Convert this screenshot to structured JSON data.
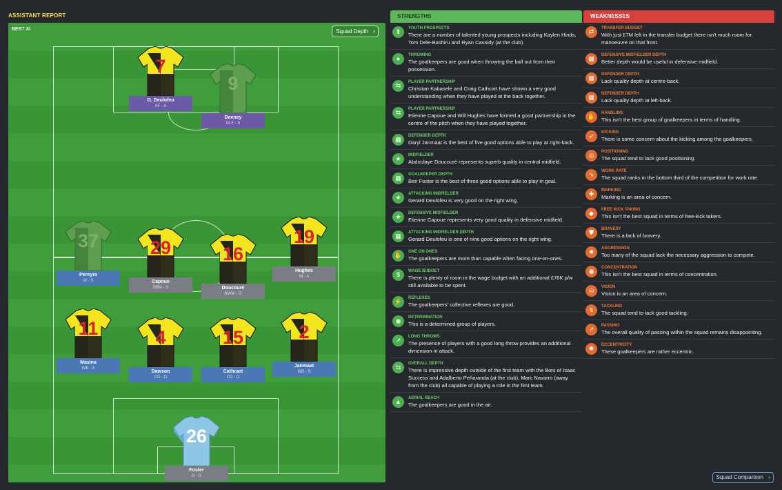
{
  "header": {
    "title": "ASSISTANT REPORT"
  },
  "pitch": {
    "label": "BEST XI",
    "squad_depth_button": "Squad Depth",
    "players": [
      {
        "name": "G. Deulofeu",
        "role": "AF - A",
        "number": "7"
      },
      {
        "name": "Deeney",
        "role": "DLF - S",
        "number": "9"
      },
      {
        "name": "Pereyra",
        "role": "W - S",
        "number": "37"
      },
      {
        "name": "Capoue",
        "role": "BBM - S",
        "number": "29"
      },
      {
        "name": "Doucouré",
        "role": "BWM - D",
        "number": "16"
      },
      {
        "name": "Hughes",
        "role": "W - A",
        "number": "19"
      },
      {
        "name": "Masina",
        "role": "WB - A",
        "number": "11"
      },
      {
        "name": "Dawson",
        "role": "CD - D",
        "number": "4"
      },
      {
        "name": "Cathcart",
        "role": "CD - D",
        "number": "15"
      },
      {
        "name": "Janmaat",
        "role": "WB - S",
        "number": "2"
      },
      {
        "name": "Foster",
        "role": "G - D",
        "number": "26"
      }
    ]
  },
  "strengths": {
    "title": "STRENGTHS",
    "items": [
      {
        "category": "YOUTH PROSPECTS",
        "text": "There are a number of talented young prospects including Kaylen Hinds, Tom Dele-Bashiru and Ryan Cassidy (at the club).",
        "icon": "youth-icon"
      },
      {
        "category": "THROWING",
        "text": "The goalkeepers are good when throwing the ball out from their possession.",
        "icon": "throwing-icon"
      },
      {
        "category": "PLAYER PARTNERSHIP",
        "text": "Christian Kabasele and Craig Cathcart have shown a very good understanding when they have played at the back together.",
        "icon": "partnership-icon"
      },
      {
        "category": "PLAYER PARTNERSHIP",
        "text": "Etienne Capoue and Will Hughes have formed a good partnership in the centre of the pitch when they have played together.",
        "icon": "partnership-icon"
      },
      {
        "category": "DEFENDER DEPTH",
        "text": "Daryl Janmaat is the best of five good options able to play at right-back.",
        "icon": "depth-icon"
      },
      {
        "category": "MIDFIELDER",
        "text": "Abdoulaye Doucouré represents superb quality in central midfield.",
        "icon": "star-icon"
      },
      {
        "category": "GOALKEEPER DEPTH",
        "text": "Ben Foster is the best of three good options able to play in goal.",
        "icon": "depth-icon"
      },
      {
        "category": "ATTACKING MIDFIELDER",
        "text": "Gerard Deulofeu is very good on the right wing.",
        "icon": "star-icon"
      },
      {
        "category": "DEFENSIVE MIDFIELDER",
        "text": "Etienne Capoue represents very good quality in defensive midfield.",
        "icon": "star-icon"
      },
      {
        "category": "ATTACKING MIDFIELDER DEPTH",
        "text": "Gerard Deulofeu is one of nine good options on the right wing.",
        "icon": "depth-icon"
      },
      {
        "category": "ONE ON ONES",
        "text": "The goalkeepers are more than capable when facing one-on-ones.",
        "icon": "one-on-one-icon"
      },
      {
        "category": "WAGE BUDGET",
        "text": "There is plenty of room in the wage budget with an additional £76K p/w still available to be spent.",
        "icon": "wage-icon"
      },
      {
        "category": "REFLEXES",
        "text": "The goalkeepers' collective reflexes are good.",
        "icon": "reflexes-icon"
      },
      {
        "category": "DETERMINATION",
        "text": "This is a determined group of players.",
        "icon": "determination-icon"
      },
      {
        "category": "LONG THROWS",
        "text": "The presence of players with a good long throw provides an additional dimension in attack.",
        "icon": "long-throw-icon"
      },
      {
        "category": "OVERALL DEPTH",
        "text": "There is impressive depth outside of the first team with the likes of Isaac Success and Adalberto Peñaranda (at the club), Marc Navarro (away from the club) all capable of playing a role in the first team.",
        "icon": "partnership-icon"
      },
      {
        "category": "AERIAL REACH",
        "text": "The goalkeepers are good in the air.",
        "icon": "aerial-icon"
      }
    ]
  },
  "weaknesses": {
    "title": "WEAKNESSES",
    "items": [
      {
        "category": "TRANSFER BUDGET",
        "text": "With just £7M left in the transfer budget there isn't much room for manoeuvre on that front.",
        "icon": "transfer-icon"
      },
      {
        "category": "DEFENSIVE MIDFIELDER DEPTH",
        "text": "Better depth would be useful in defensive midfield.",
        "icon": "depth-icon"
      },
      {
        "category": "DEFENDER DEPTH",
        "text": "Lack quality depth at centre-back.",
        "icon": "depth-icon"
      },
      {
        "category": "DEFENDER DEPTH",
        "text": "Lack quality depth at left-back.",
        "icon": "depth-icon"
      },
      {
        "category": "HANDLING",
        "text": "This isn't the best group of goalkeepers in terms of handling.",
        "icon": "handling-icon"
      },
      {
        "category": "KICKING",
        "text": "There is some concern about the kicking among the goalkeepers.",
        "icon": "kicking-icon"
      },
      {
        "category": "POSITIONING",
        "text": "The squad tend to lack good positioning.",
        "icon": "positioning-icon"
      },
      {
        "category": "WORK RATE",
        "text": "The squad ranks in the bottom third of the competition for work rate.",
        "icon": "work-rate-icon"
      },
      {
        "category": "MARKING",
        "text": "Marking is an area of concern.",
        "icon": "marking-icon"
      },
      {
        "category": "FREE KICK TAKING",
        "text": "This isn't the best squad in terms of free-kick takers.",
        "icon": "free-kick-icon"
      },
      {
        "category": "BRAVERY",
        "text": "There is a lack of bravery.",
        "icon": "bravery-icon"
      },
      {
        "category": "AGGRESSION",
        "text": "Too many of the squad lack the necessary aggression to compete.",
        "icon": "aggression-icon"
      },
      {
        "category": "CONCENTRATION",
        "text": "This isn't the best squad in terms of concentration.",
        "icon": "concentration-icon"
      },
      {
        "category": "VISION",
        "text": "Vision is an area of concern.",
        "icon": "vision-icon"
      },
      {
        "category": "TACKLING",
        "text": "The squad tend to lack good tackling.",
        "icon": "tackling-icon"
      },
      {
        "category": "PASSING",
        "text": "The overall quality of passing within the squad remains disappointing.",
        "icon": "passing-icon"
      },
      {
        "category": "ECCENTRICITY",
        "text": "These goalkeepers are rather eccentric.",
        "icon": "eccentricity-icon"
      }
    ]
  },
  "footer": {
    "squad_comparison_button": "Squad Comparison"
  },
  "colors": {
    "accent_yellow": "#f2e640",
    "strength_green": "#5cb85a",
    "weakness_red": "#d9403a",
    "pitch_green": "#3d9a3a"
  }
}
